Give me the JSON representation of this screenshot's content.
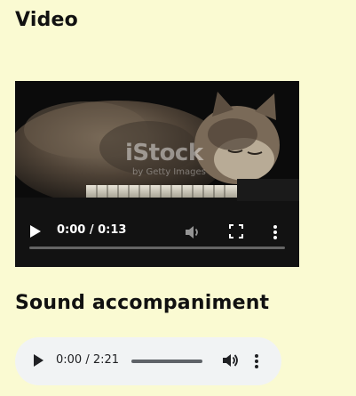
{
  "sections": {
    "video_heading": "Video",
    "audio_heading": "Sound accompaniment"
  },
  "video": {
    "watermark": "iStock",
    "watermark_sub": "by Getty Images",
    "time": "0:00 / 0:13",
    "progress": 0,
    "icons": {
      "play": "play-icon",
      "volume": "volume-icon",
      "fullscreen": "fullscreen-icon",
      "menu": "more-options-icon"
    }
  },
  "audio": {
    "time": "0:00 / 2:21",
    "progress": 0,
    "icons": {
      "play": "play-icon",
      "volume": "volume-icon",
      "menu": "more-options-icon"
    }
  },
  "colors": {
    "page_background": "#fafad2",
    "audio_background": "#f1f3f4",
    "video_background": "#0b0b0b"
  }
}
